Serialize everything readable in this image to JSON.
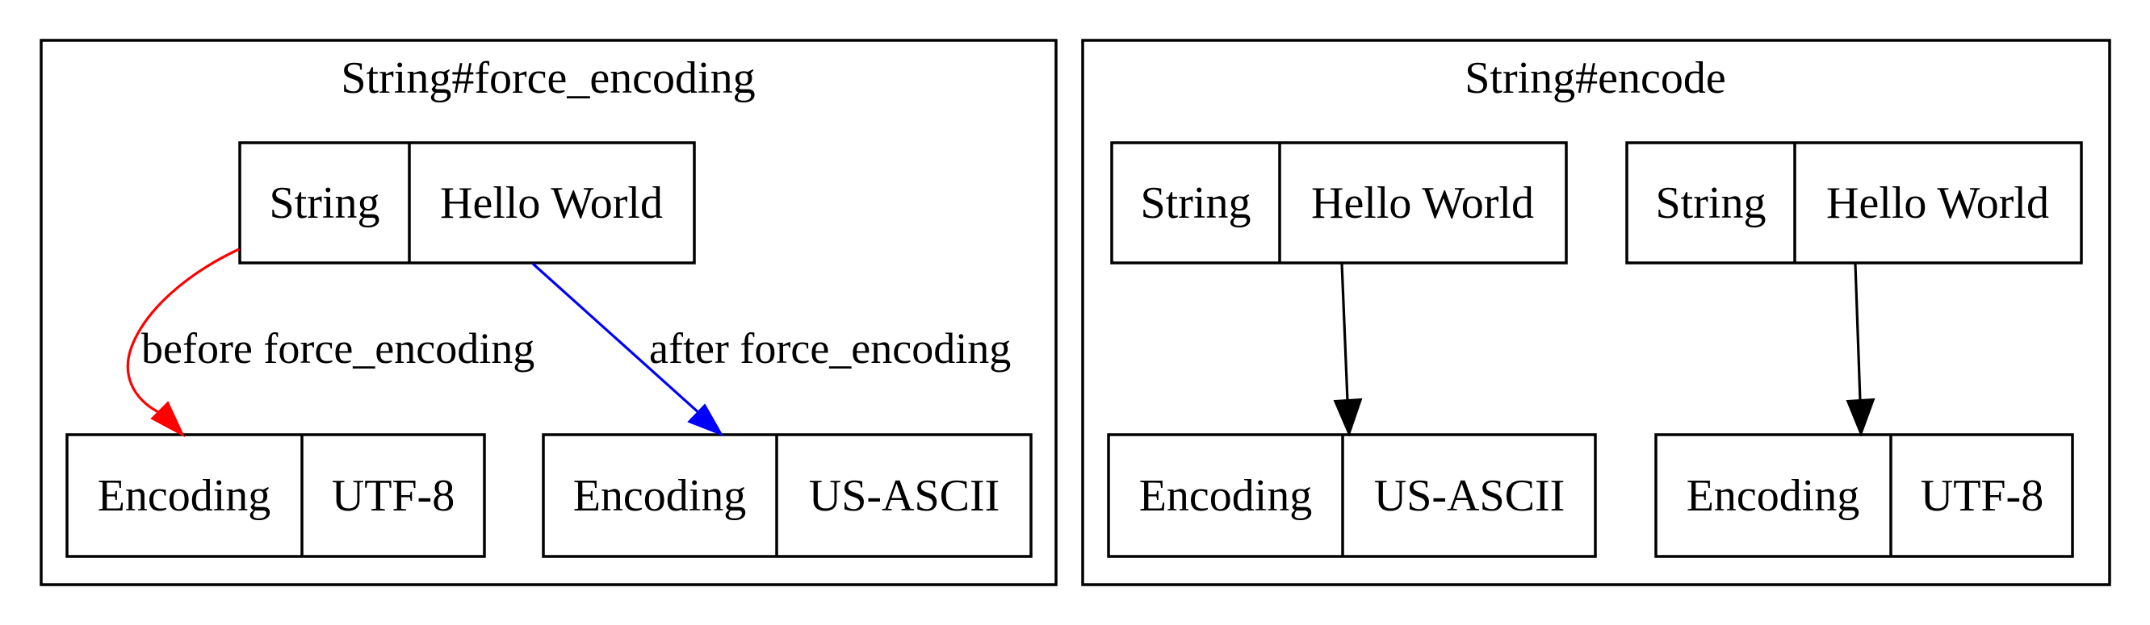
{
  "clusters": [
    {
      "title": "String#force_encoding",
      "nodes": {
        "src": {
          "type": "String",
          "value": "Hello World"
        },
        "before": {
          "type": "Encoding",
          "value": "UTF-8"
        },
        "after": {
          "type": "Encoding",
          "value": "US-ASCII"
        }
      },
      "edges": [
        {
          "from": "src",
          "to": "before",
          "label": "before force_encoding",
          "color": "#ff0000"
        },
        {
          "from": "src",
          "to": "after",
          "label": "after force_encoding",
          "color": "#0000ff"
        }
      ]
    },
    {
      "title": "String#encode",
      "nodes": {
        "src_left": {
          "type": "String",
          "value": "Hello World"
        },
        "src_right": {
          "type": "String",
          "value": "Hello World"
        },
        "enc_left": {
          "type": "Encoding",
          "value": "US-ASCII"
        },
        "enc_right": {
          "type": "Encoding",
          "value": "UTF-8"
        }
      },
      "edges": [
        {
          "from": "src_left",
          "to": "enc_left",
          "label": "",
          "color": "#000000"
        },
        {
          "from": "src_right",
          "to": "enc_right",
          "label": "",
          "color": "#000000"
        }
      ]
    }
  ]
}
